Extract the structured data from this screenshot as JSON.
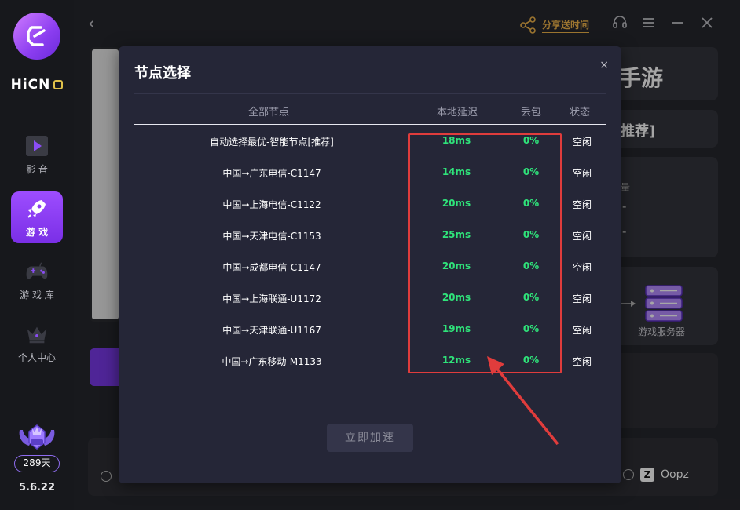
{
  "app": {
    "brand": "HiCN",
    "version": "5.6.22",
    "vip_days": "289天"
  },
  "sidebar": {
    "items": [
      {
        "label": "影 音",
        "icon": "play-icon"
      },
      {
        "label": "游 戏",
        "icon": "rocket-icon",
        "active": true
      },
      {
        "label": "游 戏 库",
        "icon": "gamepad-icon"
      },
      {
        "label": "个人中心",
        "icon": "crown-icon"
      }
    ]
  },
  "topbar": {
    "share_label": "分享送时间"
  },
  "background": {
    "title_fragment": "手游",
    "recommend_fragment": "推荐]",
    "server_label": "游戏服务器",
    "oopz_label": "Oopz",
    "small_a": "量",
    "dash1": "-",
    "dash2": "-"
  },
  "modal": {
    "title": "节点选择",
    "close": "×",
    "headers": {
      "all_nodes": "全部节点",
      "latency": "本地延迟",
      "loss": "丢包",
      "status": "状态"
    },
    "rows": [
      {
        "name": "自动选择最优-智能节点[推荐]",
        "latency": "18ms",
        "loss": "0%",
        "status": "空闲"
      },
      {
        "name": "中国→广东电信-C1147",
        "latency": "14ms",
        "loss": "0%",
        "status": "空闲"
      },
      {
        "name": "中国→上海电信-C1122",
        "latency": "20ms",
        "loss": "0%",
        "status": "空闲"
      },
      {
        "name": "中国→天津电信-C1153",
        "latency": "25ms",
        "loss": "0%",
        "status": "空闲"
      },
      {
        "name": "中国→成都电信-C1147",
        "latency": "20ms",
        "loss": "0%",
        "status": "空闲"
      },
      {
        "name": "中国→上海联通-U1172",
        "latency": "20ms",
        "loss": "0%",
        "status": "空闲"
      },
      {
        "name": "中国→天津联通-U1167",
        "latency": "19ms",
        "loss": "0%",
        "status": "空闲"
      },
      {
        "name": "中国→广东移动-M1133",
        "latency": "12ms",
        "loss": "0%",
        "status": "空闲"
      }
    ],
    "accelerate_label": "立即加速"
  },
  "colors": {
    "accent_purple": "#8b3df0",
    "latency_green": "#2fe37a",
    "highlight_red": "#e03c3c",
    "share_orange": "#f0b44a"
  }
}
